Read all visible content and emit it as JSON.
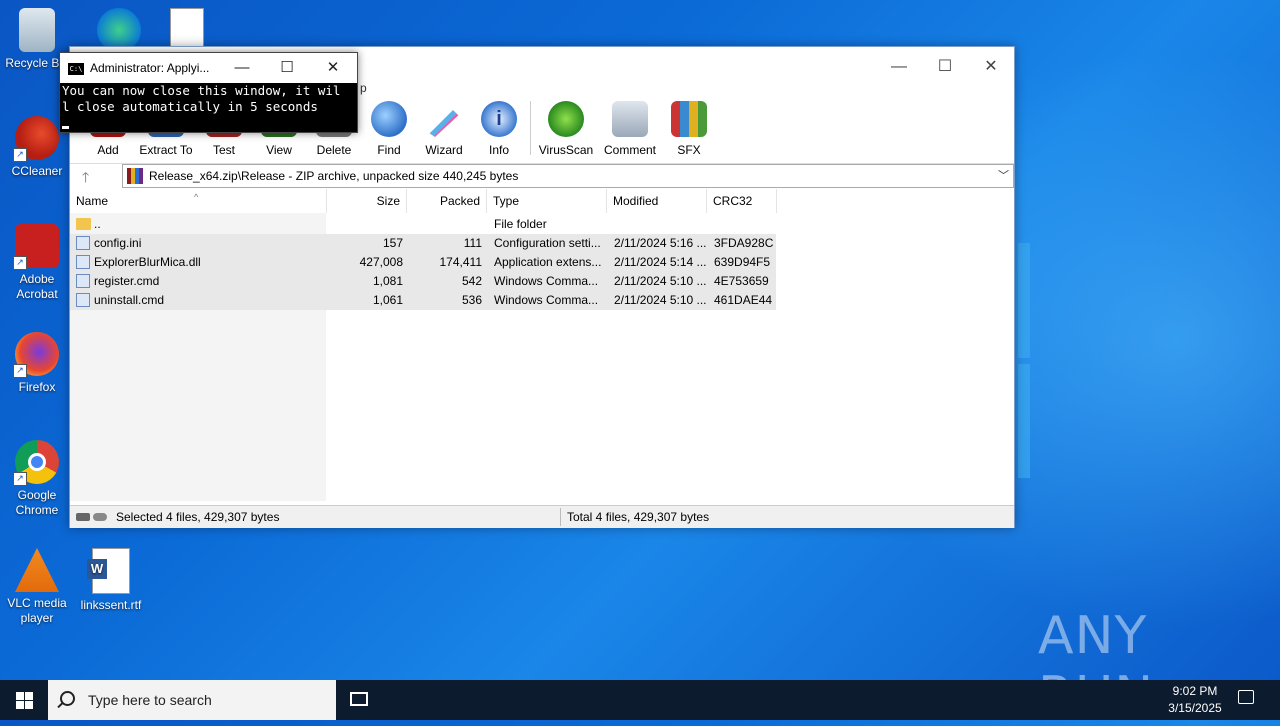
{
  "desktop": {
    "icons": [
      {
        "label": "Recycle Bin"
      },
      {
        "label": "CCleaner"
      },
      {
        "label": "Adobe Acrobat"
      },
      {
        "label": "Firefox"
      },
      {
        "label": "Google Chrome"
      },
      {
        "label": "VLC media player"
      },
      {
        "label": "linkssent.rtf"
      }
    ],
    "watermark": "ANY RUN"
  },
  "winrar": {
    "menu_fragment": "p",
    "toolbar": [
      {
        "label": "Add",
        "icon": "add-icon"
      },
      {
        "label": "Extract To",
        "icon": "extract-icon"
      },
      {
        "label": "Test",
        "icon": "test-icon"
      },
      {
        "label": "View",
        "icon": "view-icon"
      },
      {
        "label": "Delete",
        "icon": "delete-icon"
      },
      {
        "label": "Find",
        "icon": "find-icon"
      },
      {
        "label": "Wizard",
        "icon": "wizard-icon"
      },
      {
        "label": "Info",
        "icon": "info-icon"
      },
      {
        "label": "VirusScan",
        "icon": "virusscan-icon"
      },
      {
        "label": "Comment",
        "icon": "comment-icon"
      },
      {
        "label": "SFX",
        "icon": "sfx-icon"
      }
    ],
    "address": "Release_x64.zip\\Release - ZIP archive, unpacked size 440,245 bytes",
    "columns": {
      "name": "Name",
      "size": "Size",
      "packed": "Packed",
      "type": "Type",
      "modified": "Modified",
      "crc": "CRC32"
    },
    "rows": [
      {
        "name": "..",
        "size": "",
        "packed": "",
        "type": "File folder",
        "modified": "",
        "crc": ""
      },
      {
        "name": "config.ini",
        "size": "157",
        "packed": "111",
        "type": "Configuration setti...",
        "modified": "2/11/2024 5:16 ...",
        "crc": "3FDA928C"
      },
      {
        "name": "ExplorerBlurMica.dll",
        "size": "427,008",
        "packed": "174,411",
        "type": "Application extens...",
        "modified": "2/11/2024 5:14 ...",
        "crc": "639D94F5"
      },
      {
        "name": "register.cmd",
        "size": "1,081",
        "packed": "542",
        "type": "Windows Comma...",
        "modified": "2/11/2024 5:10 ...",
        "crc": "4E753659"
      },
      {
        "name": "uninstall.cmd",
        "size": "1,061",
        "packed": "536",
        "type": "Windows Comma...",
        "modified": "2/11/2024 5:10 ...",
        "crc": "461DAE44"
      }
    ],
    "status_left": "Selected 4 files, 429,307 bytes",
    "status_right": "Total 4 files, 429,307 bytes"
  },
  "cmd": {
    "title": "Administrator:  Applyi...",
    "line1": "You can now close this window, it wil",
    "line2": "l close automatically in 5 seconds"
  },
  "taskbar": {
    "search_placeholder": "Type here to search",
    "time": "9:02 PM",
    "date": "3/15/2025"
  }
}
